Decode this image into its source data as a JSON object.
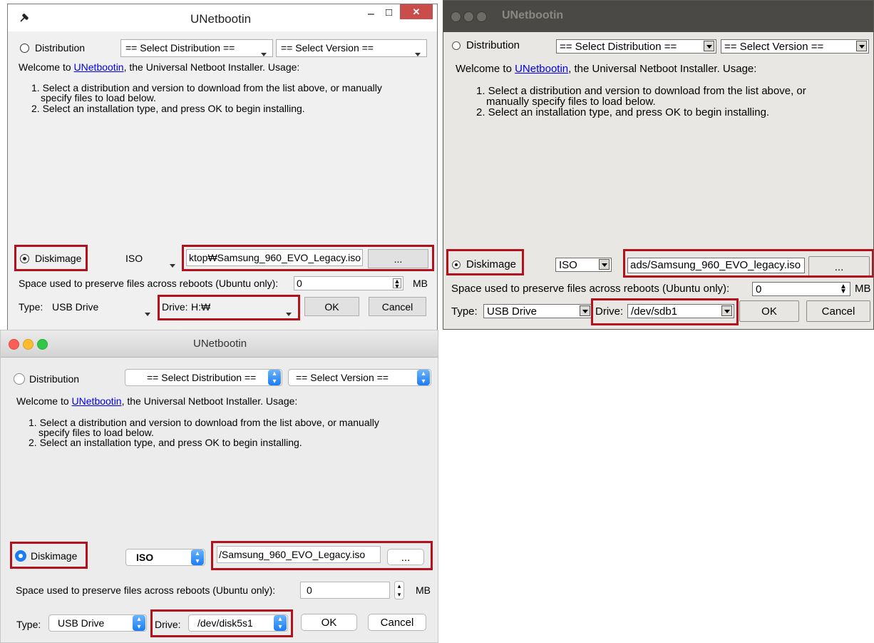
{
  "windows": {
    "title": "UNetbootin",
    "distribution_label": "Distribution",
    "select_distribution": "== Select Distribution ==",
    "select_version": "== Select Version ==",
    "welcome_prefix": "Welcome to ",
    "welcome_link": "UNetbootin",
    "welcome_suffix": ", the Universal Netboot Installer. Usage:",
    "instruction_1a": "1. Select a distribution and version to download from the list above, or manually",
    "instruction_1b": "specify files to load below.",
    "instruction_2": "2. Select an installation type, and press OK to begin installing.",
    "diskimage_label": "Diskimage",
    "diskimage_type": "ISO",
    "iso_path": "ktop₩Samsung_960_EVO_Legacy.iso",
    "browse_label": "...",
    "space_label": "Space used to preserve files across reboots (Ubuntu only):",
    "space_value": "0",
    "space_unit": "MB",
    "type_label": "Type:",
    "type_value": "USB Drive",
    "drive_label": "Drive:",
    "drive_value": "H:₩",
    "ok_label": "OK",
    "cancel_label": "Cancel",
    "minimize": "–",
    "maximize": "□",
    "close": "✕"
  },
  "ubuntu": {
    "title": "UNetbootin",
    "distribution_label": "Distribution",
    "select_distribution": "== Select Distribution ==",
    "select_version": "== Select Version ==",
    "welcome_prefix": "Welcome to ",
    "welcome_link": "UNetbootin",
    "welcome_suffix": ", the Universal Netboot Installer. Usage:",
    "instruction_1a": "1. Select a distribution and version to download from the list above, or",
    "instruction_1b": "manually specify files to load below.",
    "instruction_2": "2. Select an installation type, and press OK to begin installing.",
    "diskimage_label": "Diskimage",
    "diskimage_type": "ISO",
    "iso_path": "ads/Samsung_960_EVO_legacy.iso",
    "browse_label": "...",
    "space_label": "Space used to preserve files across reboots (Ubuntu only):",
    "space_value": "0",
    "space_unit": "MB",
    "type_label": "Type:",
    "type_value": "USB Drive",
    "drive_label": "Drive:",
    "drive_value": "/dev/sdb1",
    "ok_label": "OK",
    "cancel_label": "Cancel"
  },
  "mac": {
    "title": "UNetbootin",
    "distribution_label": "Distribution",
    "select_distribution": "== Select Distribution ==",
    "select_version": "== Select Version ==",
    "welcome_prefix": "Welcome to ",
    "welcome_link": "UNetbootin",
    "welcome_suffix": ", the Universal Netboot Installer. Usage:",
    "instruction_1a": "1. Select a distribution and version to download from the list above, or manually",
    "instruction_1b": "specify files to load below.",
    "instruction_2": "2. Select an installation type, and press OK to begin installing.",
    "diskimage_label": "Diskimage",
    "diskimage_type": "ISO",
    "iso_path": "/Samsung_960_EVO_Legacy.iso",
    "browse_label": "...",
    "space_label": "Space used to preserve files across reboots (Ubuntu only):",
    "space_value": "0",
    "space_unit": "MB",
    "type_label": "Type:",
    "type_value": "USB Drive",
    "drive_label": "Drive:",
    "drive_value": "/dev/disk5s1",
    "ok_label": "OK",
    "cancel_label": "Cancel"
  },
  "colors": {
    "highlight": "#b3121c",
    "link": "#0000ee",
    "windows_close": "#c94d4a",
    "mac_blue": "#1a7cf5",
    "ubuntu_titlebar": "#4a4945"
  }
}
